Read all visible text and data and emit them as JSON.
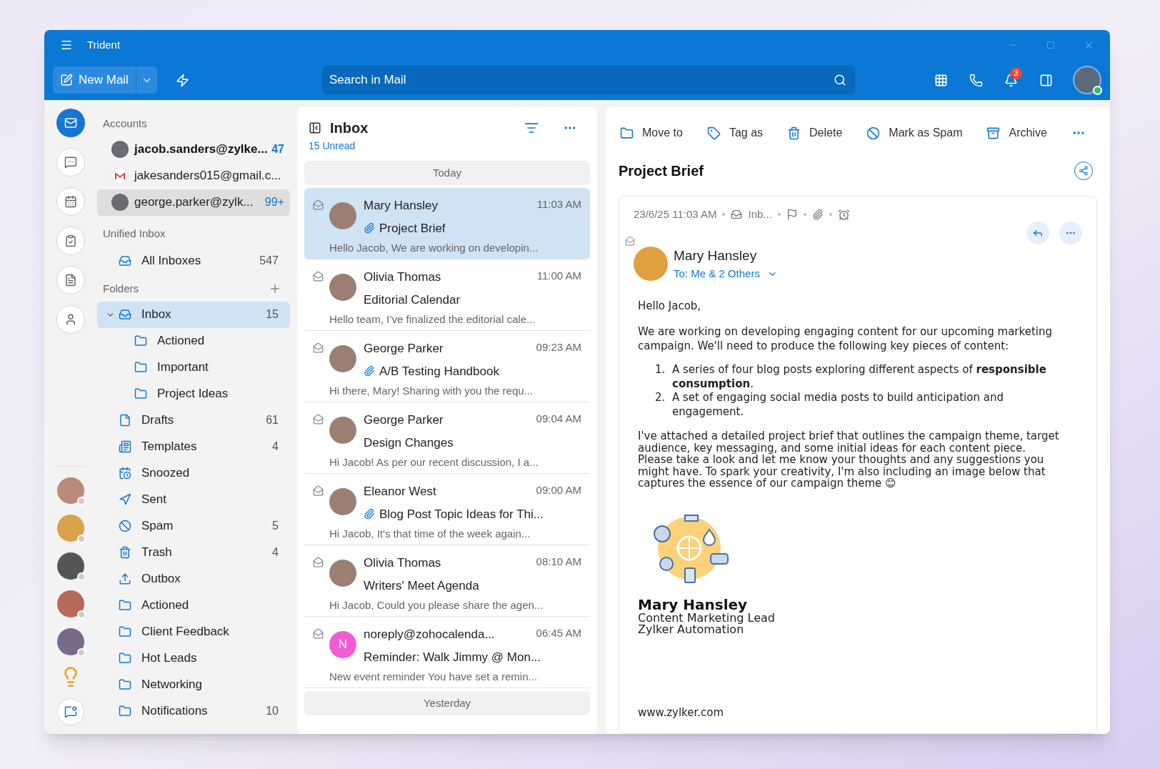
{
  "window": {
    "title": "Trident"
  },
  "toolbar": {
    "new_mail": "New Mail",
    "search": {
      "placeholder": "Search in Mail"
    },
    "notification_count": "3",
    "online": true
  },
  "rail": {
    "items": [
      {
        "kind": "mail",
        "selected": true
      },
      {
        "kind": "chat",
        "selected": false
      },
      {
        "kind": "calendar",
        "selected": false
      },
      {
        "kind": "tasks",
        "selected": false
      },
      {
        "kind": "notes",
        "selected": false
      },
      {
        "kind": "contacts",
        "selected": false
      }
    ]
  },
  "accounts": {
    "heading": "Accounts",
    "items": [
      {
        "address": "jacob.sanders@zylke...",
        "count": "47",
        "kind": "photo",
        "selected": true,
        "hovered": false
      },
      {
        "address": "jakesanders015@gmail.c...",
        "kind": "gmail",
        "selected": false,
        "hovered": false
      },
      {
        "address": "george.parker@zylk...",
        "count": "99+",
        "kind": "photo",
        "selected": false,
        "hovered": true
      }
    ]
  },
  "unified": {
    "heading": "Unified Inbox",
    "items": [
      {
        "name": "All Inboxes",
        "count": "547",
        "kind": "inbox"
      }
    ]
  },
  "folders": {
    "heading": "Folders",
    "items": [
      {
        "name": "Inbox",
        "count": "15",
        "kind": "inbox",
        "selected": true,
        "expanded": true,
        "children": [
          {
            "name": "Actioned",
            "kind": "folder",
            "selected": false
          },
          {
            "name": "Important",
            "kind": "folder",
            "selected": false
          },
          {
            "name": "Project Ideas",
            "kind": "folder",
            "selected": false
          }
        ]
      },
      {
        "name": "Drafts",
        "count": "61",
        "kind": "drafts",
        "selected": false
      },
      {
        "name": "Templates",
        "count": "4",
        "kind": "templates",
        "selected": false
      },
      {
        "name": "Snoozed",
        "kind": "snoozed",
        "selected": false
      },
      {
        "name": "Sent",
        "kind": "sent",
        "selected": false
      },
      {
        "name": "Spam",
        "count": "5",
        "kind": "spam",
        "selected": false
      },
      {
        "name": "Trash",
        "count": "4",
        "kind": "trash",
        "selected": false
      },
      {
        "name": "Outbox",
        "kind": "outbox",
        "selected": false
      },
      {
        "name": "Actioned",
        "kind": "folder",
        "selected": false
      },
      {
        "name": "Client Feedback",
        "kind": "folder",
        "selected": false
      },
      {
        "name": "Hot Leads",
        "kind": "folder",
        "selected": false
      },
      {
        "name": "Networking",
        "kind": "folder",
        "selected": false
      },
      {
        "name": "Notifications",
        "count": "10",
        "kind": "folder",
        "selected": false
      }
    ]
  },
  "message_list": {
    "title": "Inbox",
    "unread": "15 Unread",
    "sections": [
      {
        "label": "Today",
        "messages": [
          {
            "sender": "Mary Hansley",
            "time": "11:03 AM",
            "subject": "Project Brief",
            "attachment": true,
            "preview": "Hello Jacob, We are working on developin...",
            "selected": true
          },
          {
            "sender": "Olivia Thomas",
            "time": "11:00 AM",
            "subject": "Editorial Calendar",
            "attachment": false,
            "preview": "Hello team, I’ve finalized the editorial cale...",
            "selected": false
          },
          {
            "sender": "George Parker",
            "time": "09:23 AM",
            "subject": "A/B Testing Handbook",
            "attachment": true,
            "preview": "Hi there, Mary! Sharing with you the requ...",
            "selected": false
          },
          {
            "sender": "George Parker",
            "time": "09:04 AM",
            "subject": "Design Changes",
            "attachment": false,
            "preview": "Hi Jacob! As per our recent discussion, I a...",
            "selected": false
          },
          {
            "sender": "Eleanor West",
            "time": "09:00 AM",
            "subject": "Blog Post Topic Ideas for Thi...",
            "attachment": true,
            "preview": "Hi Jacob, It's that time of the week again...",
            "selected": false
          },
          {
            "sender": "Olivia Thomas",
            "time": "08:10 AM",
            "subject": "Writers' Meet Agenda",
            "attachment": false,
            "preview": "Hi Jacob, Could you please share the agen...",
            "selected": false
          },
          {
            "sender": "noreply@zohocalenda...",
            "time": "06:45 AM",
            "subject": "Reminder: Walk Jimmy @ Mon...",
            "attachment": false,
            "preview": "New event reminder You have set a remin...",
            "selected": false,
            "initial": "N",
            "color": "#f25bd3"
          }
        ]
      },
      {
        "label": "Yesterday"
      }
    ]
  },
  "reader": {
    "actions": [
      {
        "label": "Move to",
        "kind": "move"
      },
      {
        "label": "Tag as",
        "kind": "tag"
      },
      {
        "label": "Delete",
        "kind": "delete"
      },
      {
        "label": "Mark as Spam",
        "kind": "spam"
      },
      {
        "label": "Archive",
        "kind": "archive"
      }
    ],
    "subject": "Project Brief",
    "date": "23/6/25 11:03 AM",
    "folder": "Inb...",
    "sender": "Mary Hansley",
    "recipients": "To: Me & 2 Others",
    "body": {
      "greeting": "Hello Jacob,",
      "intro": "We are working on developing engaging content for our upcoming marketing campaign. We'll need to produce the following key pieces of content:",
      "list": [
        {
          "number": "1.",
          "text": "A series of four blog posts exploring different aspects of **responsible consumption**."
        },
        {
          "number": "2.",
          "text": "A set of engaging social media posts to build anticipation and engagement."
        }
      ],
      "paragraph": "I've attached a detailed project brief that outlines the campaign theme, target audience, key messaging, and some initial ideas for each content piece. Please take a look and let me know your thoughts and any suggestions you might have. To spark your creativity, I'm also including an image below that captures the essence of our campaign theme 😊",
      "signature": {
        "name": "Mary Hansley",
        "title": "Content Marketing Lead",
        "company": "Zylker Automation",
        "website": "www.zylker.com"
      }
    }
  }
}
